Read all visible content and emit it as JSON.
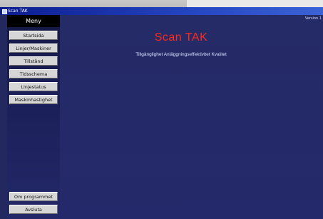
{
  "window": {
    "title": "Scan TAK"
  },
  "sidebar": {
    "header": "Meny",
    "items": [
      {
        "label": "Startsida"
      },
      {
        "label": "Linjer/Maskiner"
      },
      {
        "label": "Tillstånd"
      },
      {
        "label": "Tidsschema"
      },
      {
        "label": "Linjestatus"
      },
      {
        "label": "Maskinhastighet"
      }
    ],
    "bottom_items": [
      {
        "label": "Om programmet"
      },
      {
        "label": "Avsluta"
      }
    ]
  },
  "main": {
    "version": "Version 1",
    "title": "Scan TAK",
    "subtitle": "Tillgänglighet Anläggningseffektivitet Kvalitet"
  }
}
